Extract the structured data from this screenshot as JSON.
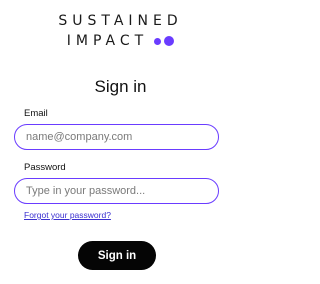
{
  "brand": {
    "line1": "SUSTAINED",
    "line2": "IMPACT",
    "accent_color": "#6a3cff"
  },
  "form": {
    "title": "Sign in",
    "email": {
      "label": "Email",
      "placeholder": "name@company.com",
      "value": ""
    },
    "password": {
      "label": "Password",
      "placeholder": "Type in your password...",
      "value": ""
    },
    "forgot_link": "Forgot your password?",
    "submit_label": "Sign in"
  }
}
